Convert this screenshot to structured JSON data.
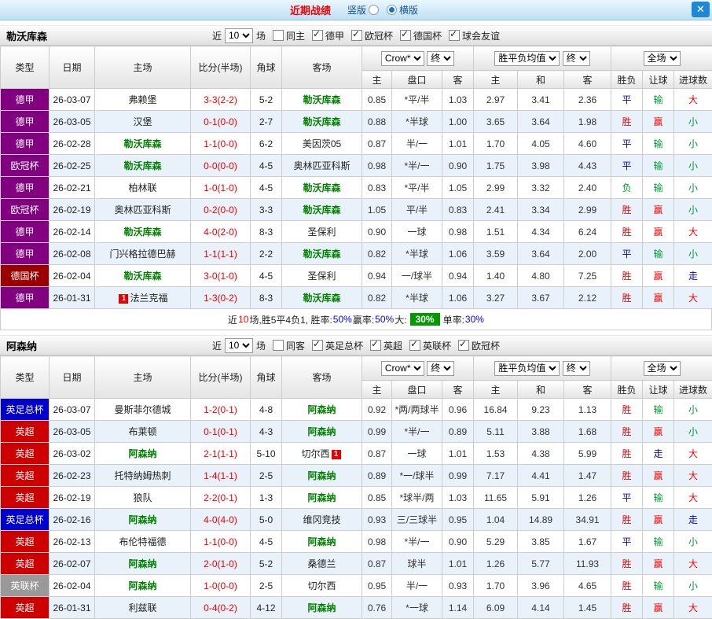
{
  "titlebar": {
    "title": "近期战绩",
    "radio_vertical": "竖版",
    "radio_horizontal": "横版",
    "selected_layout": "横版",
    "close": "✕"
  },
  "table_header": {
    "col_type": "类型",
    "col_date": "日期",
    "col_home": "主场",
    "col_score": "比分(半场)",
    "col_corner": "角球",
    "col_away": "客场",
    "odds_company": "Crow*",
    "final_label": "终",
    "europe_label": "胜平负均值",
    "full_label": "全场",
    "sub_home": "主",
    "sub_handicap": "盘口",
    "sub_away": "客",
    "sub_draw": "和",
    "sub_result": "胜负",
    "sub_let": "让球",
    "sub_goals": "进球数"
  },
  "league_colors": {
    "德甲": "#800080",
    "欧冠杯": "#800080",
    "德国杯": "#990000",
    "英足总杯": "#0000cc",
    "英超": "#cc0000",
    "英联杯": "#999999"
  },
  "value_colors": {
    "red": "#ff0000",
    "blue": "#0000ee",
    "green": "#009933",
    "badge_green_bg": "#009900"
  },
  "sections": [
    {
      "team": "勒沃库森",
      "filter": {
        "near_label": "近",
        "count": "10",
        "games_label": "场",
        "same_label": "同主",
        "same_checked": false,
        "leagues": [
          "德甲",
          "欧冠杯",
          "德国杯",
          "球会友谊"
        ]
      },
      "rows": [
        {
          "league": "德甲",
          "date": "26-03-07",
          "home": {
            "n": "弗赖堡"
          },
          "score": "3-3(2-2)",
          "corner": "5-2",
          "away": {
            "n": "勒沃库森",
            "f": true
          },
          "odds": [
            "0.85",
            "*平/半",
            "1.03"
          ],
          "europe": [
            "2.97",
            "3.41",
            "2.36"
          ],
          "res": [
            "平",
            "blue"
          ],
          "let": [
            "输",
            "green"
          ],
          "goal": [
            "大",
            "red"
          ]
        },
        {
          "league": "德甲",
          "date": "26-03-05",
          "home": {
            "n": "汉堡"
          },
          "score": "0-1(0-0)",
          "corner": "2-7",
          "away": {
            "n": "勒沃库森",
            "f": true
          },
          "odds": [
            "0.88",
            "*半球",
            "1.00"
          ],
          "europe": [
            "3.65",
            "3.64",
            "1.98"
          ],
          "res": [
            "胜",
            "red"
          ],
          "let": [
            "赢",
            "red"
          ],
          "goal": [
            "小",
            "green"
          ]
        },
        {
          "league": "德甲",
          "date": "26-02-28",
          "home": {
            "n": "勒沃库森",
            "f": true
          },
          "score": "1-1(0-0)",
          "corner": "6-2",
          "away": {
            "n": "美因茨05"
          },
          "odds": [
            "0.87",
            "半/一",
            "1.01"
          ],
          "europe": [
            "1.70",
            "4.05",
            "4.60"
          ],
          "res": [
            "平",
            "blue"
          ],
          "let": [
            "输",
            "green"
          ],
          "goal": [
            "小",
            "green"
          ]
        },
        {
          "league": "欧冠杯",
          "date": "26-02-25",
          "home": {
            "n": "勒沃库森",
            "f": true
          },
          "score": "0-0(0-0)",
          "corner": "4-5",
          "away": {
            "n": "奥林匹亚科斯"
          },
          "odds": [
            "0.98",
            "*半/一",
            "0.90"
          ],
          "europe": [
            "1.75",
            "3.98",
            "4.43"
          ],
          "res": [
            "平",
            "blue"
          ],
          "let": [
            "输",
            "green"
          ],
          "goal": [
            "小",
            "green"
          ]
        },
        {
          "league": "德甲",
          "date": "26-02-21",
          "home": {
            "n": "柏林联"
          },
          "score": "1-0(1-0)",
          "corner": "4-5",
          "away": {
            "n": "勒沃库森",
            "f": true
          },
          "odds": [
            "0.83",
            "*平/半",
            "1.05"
          ],
          "europe": [
            "2.99",
            "3.32",
            "2.40"
          ],
          "res": [
            "负",
            "green"
          ],
          "let": [
            "输",
            "green"
          ],
          "goal": [
            "小",
            "green"
          ]
        },
        {
          "league": "欧冠杯",
          "date": "26-02-19",
          "home": {
            "n": "奥林匹亚科斯"
          },
          "score": "0-2(0-0)",
          "corner": "3-3",
          "away": {
            "n": "勒沃库森",
            "f": true
          },
          "odds": [
            "1.05",
            "平/半",
            "0.83"
          ],
          "europe": [
            "2.41",
            "3.34",
            "2.99"
          ],
          "res": [
            "胜",
            "red"
          ],
          "let": [
            "赢",
            "red"
          ],
          "goal": [
            "小",
            "green"
          ]
        },
        {
          "league": "德甲",
          "date": "26-02-14",
          "home": {
            "n": "勒沃库森",
            "f": true
          },
          "score": "4-0(2-0)",
          "corner": "8-3",
          "away": {
            "n": "圣保利"
          },
          "odds": [
            "0.90",
            "一球",
            "0.98"
          ],
          "europe": [
            "1.51",
            "4.34",
            "6.24"
          ],
          "res": [
            "胜",
            "red"
          ],
          "let": [
            "赢",
            "red"
          ],
          "goal": [
            "大",
            "red"
          ]
        },
        {
          "league": "德甲",
          "date": "26-02-08",
          "home": {
            "n": "门兴格拉德巴赫"
          },
          "score": "1-1(1-1)",
          "corner": "2-2",
          "away": {
            "n": "勒沃库森",
            "f": true
          },
          "odds": [
            "0.82",
            "*半球",
            "1.06"
          ],
          "europe": [
            "3.59",
            "3.64",
            "2.00"
          ],
          "res": [
            "平",
            "blue"
          ],
          "let": [
            "输",
            "green"
          ],
          "goal": [
            "小",
            "green"
          ]
        },
        {
          "league": "德国杯",
          "date": "26-02-04",
          "home": {
            "n": "勒沃库森",
            "f": true
          },
          "score": "3-0(1-0)",
          "corner": "4-5",
          "away": {
            "n": "圣保利"
          },
          "odds": [
            "0.94",
            "一/球半",
            "0.94"
          ],
          "europe": [
            "1.40",
            "4.80",
            "7.25"
          ],
          "res": [
            "胜",
            "red"
          ],
          "let": [
            "赢",
            "red"
          ],
          "goal": [
            "走",
            "blue"
          ]
        },
        {
          "league": "德甲",
          "date": "26-01-31",
          "home": {
            "n": "法兰克福",
            "b": "1",
            "bp": "before"
          },
          "score": "1-3(0-2)",
          "corner": "8-3",
          "away": {
            "n": "勒沃库森",
            "f": true
          },
          "odds": [
            "0.82",
            "*半球",
            "1.06"
          ],
          "europe": [
            "3.27",
            "3.67",
            "2.12"
          ],
          "res": [
            "胜",
            "red"
          ],
          "let": [
            "赢",
            "red"
          ],
          "goal": [
            "大",
            "red"
          ]
        }
      ],
      "summary": [
        {
          "t": "近"
        },
        {
          "t": "10",
          "c": "red"
        },
        {
          "t": "场,胜5平4负1, 胜率:"
        },
        {
          "t": "50%",
          "c": "blue"
        },
        {
          "t": " 赢率:"
        },
        {
          "t": "50%",
          "c": "blue"
        },
        {
          "t": " 大:"
        },
        {
          "t": "30%",
          "badge": true
        },
        {
          "t": " 单率:"
        },
        {
          "t": "30%",
          "c": "blue"
        }
      ]
    },
    {
      "team": "阿森纳",
      "filter": {
        "near_label": "近",
        "count": "10",
        "games_label": "场",
        "same_label": "同客",
        "same_checked": false,
        "leagues": [
          "英足总杯",
          "英超",
          "英联杯",
          "欧冠杯"
        ]
      },
      "rows": [
        {
          "league": "英足总杯",
          "date": "26-03-07",
          "home": {
            "n": "曼斯菲尔德城"
          },
          "score": "1-2(0-1)",
          "corner": "4-8",
          "away": {
            "n": "阿森纳",
            "f": true
          },
          "odds": [
            "0.92",
            "*两/两球半",
            "0.96"
          ],
          "europe": [
            "16.84",
            "9.23",
            "1.13"
          ],
          "res": [
            "胜",
            "red"
          ],
          "let": [
            "输",
            "green"
          ],
          "goal": [
            "小",
            "green"
          ]
        },
        {
          "league": "英超",
          "date": "26-03-05",
          "home": {
            "n": "布莱顿"
          },
          "score": "0-1(0-1)",
          "corner": "4-3",
          "away": {
            "n": "阿森纳",
            "f": true
          },
          "odds": [
            "0.99",
            "*半/一",
            "0.89"
          ],
          "europe": [
            "5.11",
            "3.88",
            "1.68"
          ],
          "res": [
            "胜",
            "red"
          ],
          "let": [
            "赢",
            "red"
          ],
          "goal": [
            "小",
            "green"
          ]
        },
        {
          "league": "英超",
          "date": "26-03-02",
          "home": {
            "n": "阿森纳",
            "f": true
          },
          "score": "2-1(1-1)",
          "corner": "5-10",
          "away": {
            "n": "切尔西",
            "b": "1",
            "bp": "after"
          },
          "odds": [
            "0.87",
            "一球",
            "1.01"
          ],
          "europe": [
            "1.53",
            "4.38",
            "5.99"
          ],
          "res": [
            "胜",
            "red"
          ],
          "let": [
            "走",
            "blue"
          ],
          "goal": [
            "大",
            "red"
          ]
        },
        {
          "league": "英超",
          "date": "26-02-23",
          "home": {
            "n": "托特纳姆热刺"
          },
          "score": "1-4(1-1)",
          "corner": "2-5",
          "away": {
            "n": "阿森纳",
            "f": true
          },
          "odds": [
            "0.89",
            "*一/球半",
            "0.99"
          ],
          "europe": [
            "7.17",
            "4.41",
            "1.47"
          ],
          "res": [
            "胜",
            "red"
          ],
          "let": [
            "赢",
            "red"
          ],
          "goal": [
            "大",
            "red"
          ]
        },
        {
          "league": "英超",
          "date": "26-02-19",
          "home": {
            "n": "狼队"
          },
          "score": "2-2(0-1)",
          "corner": "1-3",
          "away": {
            "n": "阿森纳",
            "f": true
          },
          "odds": [
            "0.85",
            "*球半/两",
            "1.03"
          ],
          "europe": [
            "11.65",
            "5.91",
            "1.26"
          ],
          "res": [
            "平",
            "blue"
          ],
          "let": [
            "输",
            "green"
          ],
          "goal": [
            "大",
            "red"
          ]
        },
        {
          "league": "英足总杯",
          "date": "26-02-16",
          "home": {
            "n": "阿森纳",
            "f": true
          },
          "score": "4-0(4-0)",
          "corner": "5-0",
          "away": {
            "n": "维冈竞技"
          },
          "odds": [
            "0.93",
            "三/三球半",
            "0.95"
          ],
          "europe": [
            "1.04",
            "14.89",
            "34.91"
          ],
          "res": [
            "胜",
            "red"
          ],
          "let": [
            "赢",
            "red"
          ],
          "goal": [
            "走",
            "blue"
          ]
        },
        {
          "league": "英超",
          "date": "26-02-13",
          "home": {
            "n": "布伦特福德"
          },
          "score": "1-1(0-0)",
          "corner": "4-5",
          "away": {
            "n": "阿森纳",
            "f": true
          },
          "odds": [
            "0.98",
            "*半/一",
            "0.90"
          ],
          "europe": [
            "5.29",
            "3.85",
            "1.67"
          ],
          "res": [
            "平",
            "blue"
          ],
          "let": [
            "输",
            "green"
          ],
          "goal": [
            "小",
            "green"
          ]
        },
        {
          "league": "英超",
          "date": "26-02-07",
          "home": {
            "n": "阿森纳",
            "f": true
          },
          "score": "2-0(1-0)",
          "corner": "5-2",
          "away": {
            "n": "桑德兰"
          },
          "odds": [
            "0.87",
            "球半",
            "1.01"
          ],
          "europe": [
            "1.26",
            "5.77",
            "11.93"
          ],
          "res": [
            "胜",
            "red"
          ],
          "let": [
            "赢",
            "red"
          ],
          "goal": [
            "大",
            "red"
          ]
        },
        {
          "league": "英联杯",
          "date": "26-02-04",
          "home": {
            "n": "阿森纳",
            "f": true
          },
          "score": "1-0(0-0)",
          "corner": "2-5",
          "away": {
            "n": "切尔西"
          },
          "odds": [
            "0.95",
            "半/一",
            "0.93"
          ],
          "europe": [
            "1.70",
            "3.96",
            "4.65"
          ],
          "res": [
            "胜",
            "red"
          ],
          "let": [
            "输",
            "green"
          ],
          "goal": [
            "小",
            "green"
          ]
        },
        {
          "league": "英超",
          "date": "26-01-31",
          "home": {
            "n": "利兹联"
          },
          "score": "0-4(0-2)",
          "corner": "4-12",
          "away": {
            "n": "阿森纳",
            "f": true
          },
          "odds": [
            "0.76",
            "*一球",
            "1.14"
          ],
          "europe": [
            "6.09",
            "4.14",
            "1.45"
          ],
          "res": [
            "胜",
            "red"
          ],
          "let": [
            "赢",
            "red"
          ],
          "goal": [
            "大",
            "red"
          ]
        }
      ],
      "summary": null
    }
  ]
}
